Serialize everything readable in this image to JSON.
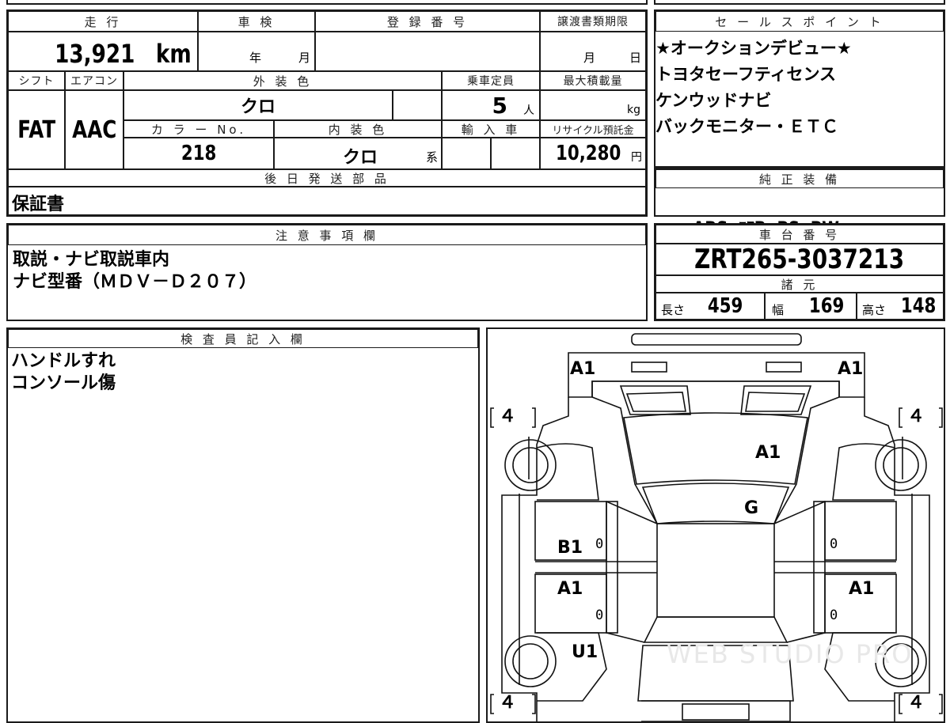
{
  "vehicle": {
    "mileage_label": "走 行",
    "mileage_value": "13,921",
    "mileage_unit": "km",
    "inspection_label": "車 検",
    "inspection_year": "年",
    "inspection_month": "月",
    "registration_label": "登 録 番 号",
    "transfer_label": "譲渡書類期限",
    "transfer_month": "月",
    "transfer_day": "日",
    "shift_label": "シフト",
    "shift_value": "FAT",
    "ac_label": "エアコン",
    "ac_value": "AAC",
    "exterior_label": "外 装 色",
    "exterior_value": "クロ",
    "capacity_label": "乗車定員",
    "capacity_value": "5",
    "capacity_unit": "人",
    "load_label": "最大積載量",
    "load_unit": "kg",
    "color_no_label": "カ ラ ー No.",
    "color_no_value": "218",
    "interior_label": "内 装 色",
    "interior_value": "クロ",
    "interior_suffix": "系",
    "import_label": "輸 入 車",
    "recycle_label": "リサイクル預託金",
    "recycle_value": "10,280",
    "recycle_unit": "円",
    "later_parts_label": "後 日 発 送 部 品",
    "later_parts_value": "保証書"
  },
  "sales": {
    "label": "セ ー ル ス ポ イ ン ト",
    "points": [
      "★オークションデビュー★",
      "トヨタセーフティセンス",
      "ケンウッドナビ",
      "バックモニター・ＥＴＣ"
    ]
  },
  "equipment": {
    "label": "純 正 装 備",
    "value": "ABS  ｴｱB  PS  PW"
  },
  "notes": {
    "label": "注 意 事 項 欄",
    "lines": [
      "取説・ナビ取説車内",
      "ナビ型番（ＭＤＶ－Ｄ２０７）"
    ]
  },
  "chassis": {
    "label": "車 台 番 号",
    "value": "ZRT265-3037213",
    "spec_label": "諸 元",
    "length_label": "長さ",
    "length_value": "459",
    "width_label": "幅",
    "width_value": "169",
    "height_label": "高さ",
    "height_value": "148"
  },
  "inspector": {
    "label": "検 査 員 記 入 欄",
    "lines": [
      "ハンドルすれ",
      "コンソール傷"
    ]
  },
  "diagram": {
    "marks": {
      "front_left": "A1",
      "front_right": "A1",
      "hood": "A1",
      "windshield": "G",
      "left_front_door": "B1",
      "left_rear_door": "A1",
      "right_rear_door": "A1",
      "left_rear_fender": "U1"
    },
    "tires": {
      "front_left": "４",
      "front_right": "４",
      "rear_left": "４",
      "rear_right": "４"
    },
    "zeros": [
      "0",
      "0",
      "0",
      "0"
    ],
    "watermark": "WEB STUDIO PRO"
  }
}
